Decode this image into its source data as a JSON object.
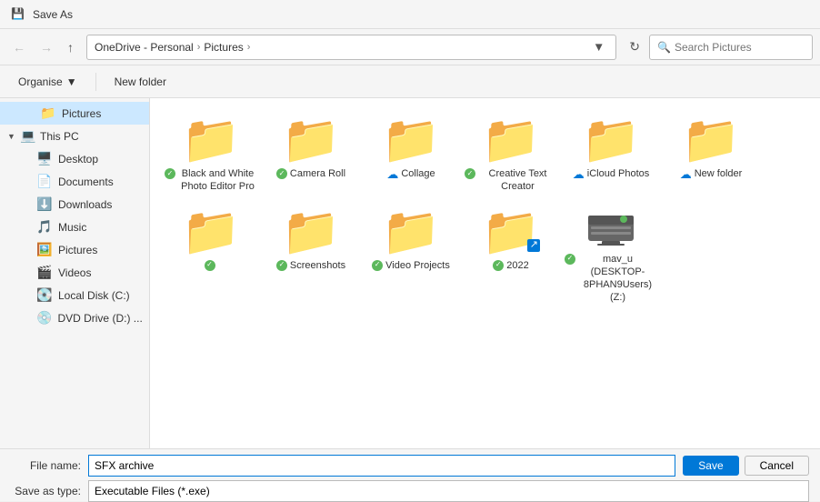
{
  "titleBar": {
    "icon": "💾",
    "title": "Save As"
  },
  "toolbar": {
    "backDisabled": true,
    "forwardDisabled": true,
    "upLabel": "Up",
    "addressParts": [
      "OneDrive - Personal",
      "Pictures"
    ],
    "refreshLabel": "Refresh",
    "searchPlaceholder": "Search Pictures"
  },
  "actionsBar": {
    "organiseLabel": "Organise",
    "newFolderLabel": "New folder"
  },
  "sidebar": {
    "groups": [
      {
        "label": "Pictures",
        "icon": "📁",
        "iconClass": "folder",
        "indent": 1,
        "active": true
      }
    ],
    "items": [
      {
        "label": "This PC",
        "icon": "💻",
        "iconClass": "special",
        "indent": 0,
        "hasArrow": true,
        "expanded": true
      },
      {
        "label": "Desktop",
        "icon": "🖥️",
        "iconClass": "special",
        "indent": 2
      },
      {
        "label": "Documents",
        "icon": "📄",
        "iconClass": "special",
        "indent": 2
      },
      {
        "label": "Downloads",
        "icon": "⬇️",
        "iconClass": "special",
        "indent": 2
      },
      {
        "label": "Music",
        "icon": "🎵",
        "iconClass": "special",
        "indent": 2
      },
      {
        "label": "Pictures",
        "icon": "🖼️",
        "iconClass": "special",
        "indent": 2
      },
      {
        "label": "Videos",
        "icon": "🎬",
        "iconClass": "special",
        "indent": 2
      },
      {
        "label": "Local Disk (C:)",
        "icon": "💽",
        "iconClass": "drive",
        "indent": 2
      },
      {
        "label": "DVD Drive (D:)",
        "icon": "💿",
        "iconClass": "drive",
        "indent": 2
      },
      {
        "label": "...",
        "icon": "💽",
        "iconClass": "drive",
        "indent": 2
      }
    ]
  },
  "folders": [
    {
      "name": "Black and White Photo Editor Pro",
      "status": "green",
      "type": "folder"
    },
    {
      "name": "Camera Roll",
      "status": "green",
      "type": "folder"
    },
    {
      "name": "Collage",
      "status": "blue-cloud",
      "type": "folder"
    },
    {
      "name": "Creative Text Creator",
      "status": "green",
      "type": "folder"
    },
    {
      "name": "iCloud Photos",
      "status": "blue-cloud",
      "type": "folder"
    },
    {
      "name": "New folder",
      "status": "blue-cloud",
      "type": "folder"
    },
    {
      "name": "Screenshots",
      "status": "green",
      "type": "folder"
    },
    {
      "name": "Video Projects",
      "status": "green",
      "type": "folder"
    },
    {
      "name": "2022",
      "status": "green",
      "type": "folder"
    }
  ],
  "networkItem": {
    "name": "mav_u (DESKTOP-8PHAN9Users) (Z:)",
    "status": "green"
  },
  "bottomBar": {
    "fileNameLabel": "File name:",
    "fileNameValue": "SFX archive",
    "saveTypeLabel": "Save as type:",
    "saveTypeValue": "Executable Files (*.exe)",
    "saveLabel": "Save",
    "cancelLabel": "Cancel"
  }
}
